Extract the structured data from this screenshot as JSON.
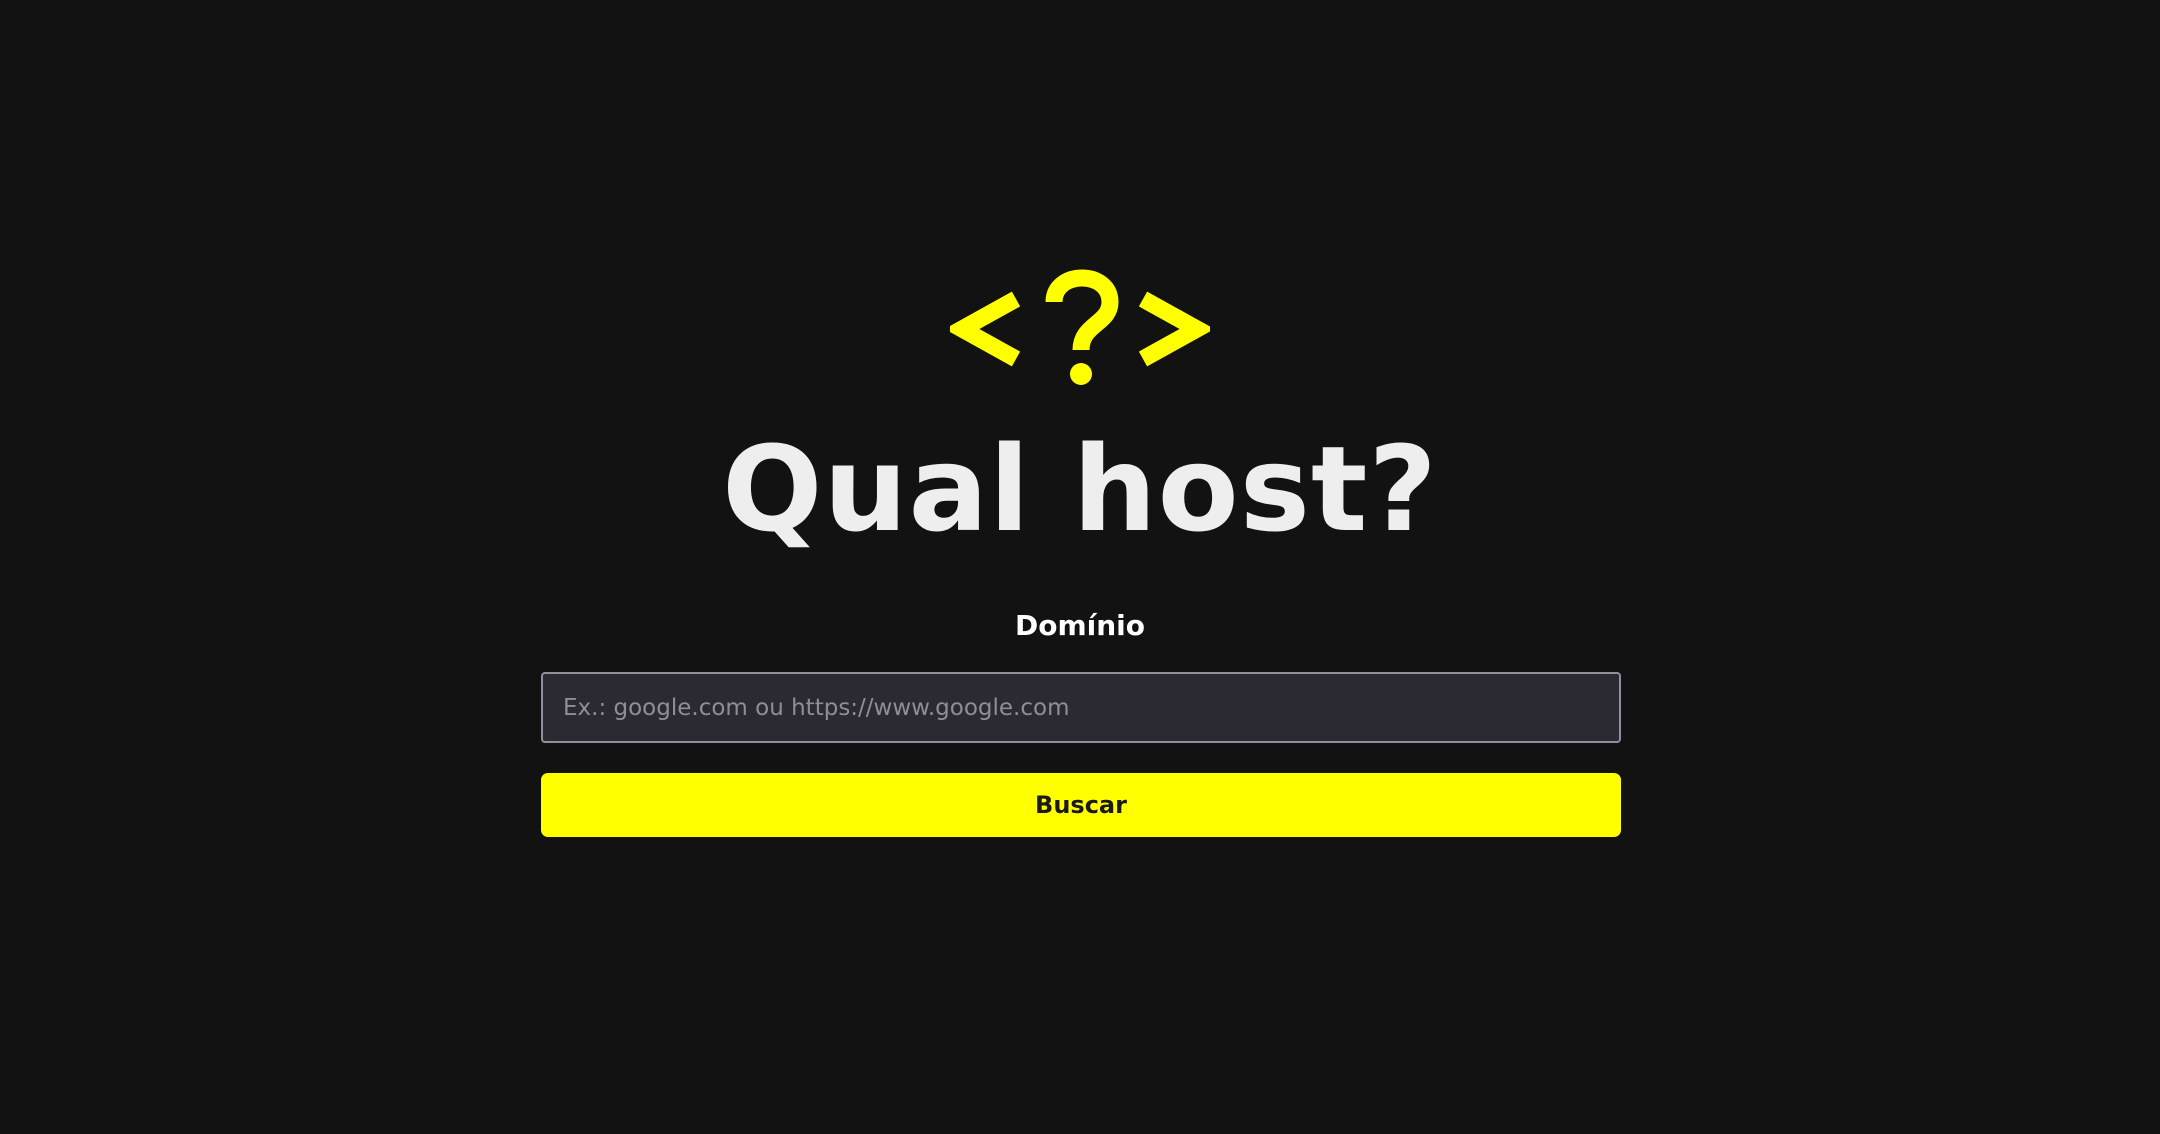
{
  "logo": {
    "icon": "code-question-icon",
    "left_glyph": "<",
    "middle_glyph": "?",
    "right_glyph": ">",
    "color": "#ffff00"
  },
  "header": {
    "title": "Qual host?"
  },
  "form": {
    "domain_label": "Domínio",
    "domain_input": {
      "value": "",
      "placeholder": "Ex.: google.com ou https://www.google.com"
    },
    "search_button_label": "Buscar"
  },
  "colors": {
    "background": "#121212",
    "accent": "#ffff00",
    "input_background": "#2b2a33",
    "input_border": "#8f8f9d",
    "title_text": "#eeeeee"
  }
}
